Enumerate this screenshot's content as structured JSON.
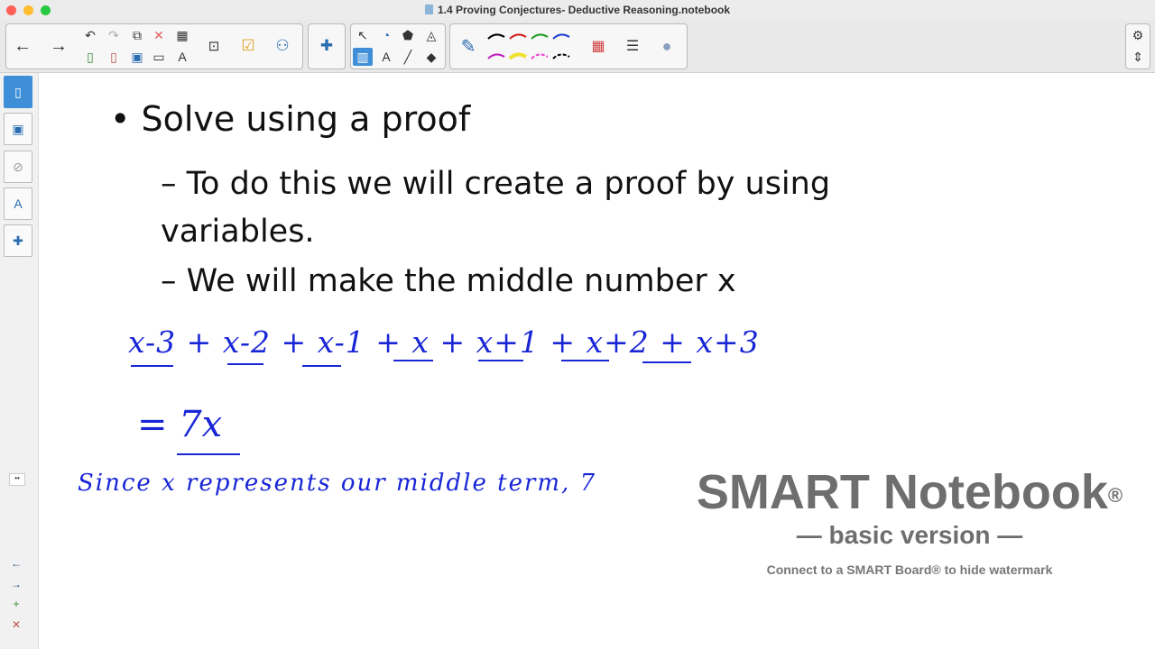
{
  "window": {
    "title": "1.4 Proving Conjectures- Deductive Reasoning.notebook"
  },
  "toolbar": {
    "back": "←",
    "forward": "→",
    "undo": "↶",
    "redo": "↷",
    "delete": "✕",
    "table": "▦",
    "select": "↖",
    "text_tool": "A",
    "line_tool": "╱",
    "eraser": "◆",
    "pen": "✎",
    "settings": "⚙",
    "expand": "⇕"
  },
  "sidebar": {
    "page_sorter": "▯",
    "gallery": "▣",
    "attachments": "⊘",
    "properties": "A",
    "addons": "✚",
    "collapse": "••",
    "prev_page": "←",
    "next_page": "→",
    "add_page": "+",
    "delete_page": "✕"
  },
  "slide": {
    "bullet1": "•  Solve using a proof",
    "bullet2": "– To do this we will create a proof by using variables.",
    "bullet3": "– We will make the middle number x"
  },
  "handwriting": {
    "equation": "x-3 + x-2 + x-1 + x + x+1 + x+2 + x+3",
    "result": "= 7x",
    "note": "Since x represents our middle term, 7"
  },
  "watermark": {
    "title": "SMART Notebook",
    "reg": "®",
    "subtitle": "— basic version —",
    "note": "Connect to a SMART Board® to hide watermark"
  },
  "colors": {
    "ink": "#1826d6",
    "accent": "#3e8fd8",
    "watermark": "#6e6e6e"
  }
}
